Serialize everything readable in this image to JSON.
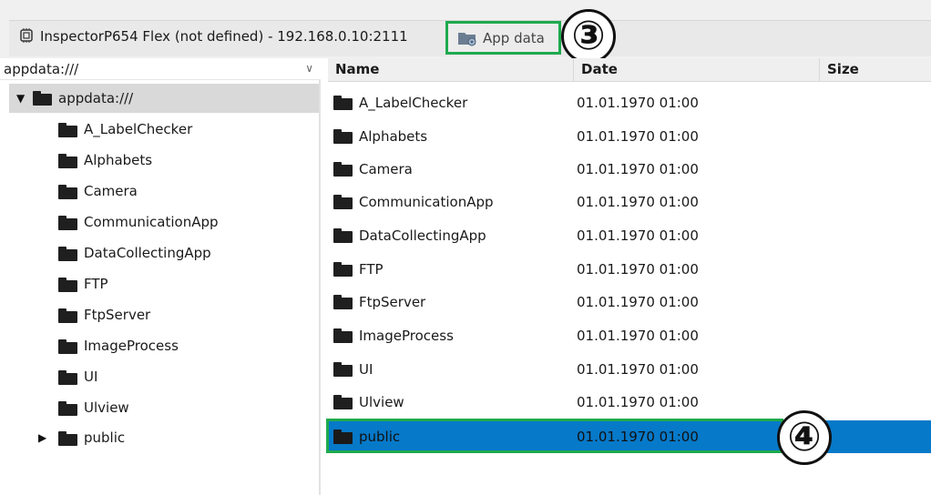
{
  "device_bar": {
    "title": "InspectorP654 Flex (not defined) - 192.168.0.10:2111",
    "appdata_button_label": "App data",
    "icons": {
      "device": "device-chip-icon",
      "appdata": "folder-gear-icon"
    }
  },
  "callouts": {
    "app_data": "③",
    "selected_row": "④"
  },
  "tree": {
    "path_value": "appdata:///",
    "root_label": "appdata:///",
    "items": [
      {
        "label": "A_LabelChecker"
      },
      {
        "label": "Alphabets"
      },
      {
        "label": "Camera"
      },
      {
        "label": "CommunicationApp"
      },
      {
        "label": "DataCollectingApp"
      },
      {
        "label": "FTP"
      },
      {
        "label": "FtpServer"
      },
      {
        "label": "ImageProcess"
      },
      {
        "label": "UI"
      },
      {
        "label": "Ulview"
      },
      {
        "label": "public",
        "expandable": true
      }
    ]
  },
  "list": {
    "columns": [
      "Name",
      "Date",
      "Size"
    ],
    "rows": [
      {
        "name": "A_LabelChecker",
        "date": "01.01.1970 01:00"
      },
      {
        "name": "Alphabets",
        "date": "01.01.1970 01:00"
      },
      {
        "name": "Camera",
        "date": "01.01.1970 01:00"
      },
      {
        "name": "CommunicationApp",
        "date": "01.01.1970 01:00"
      },
      {
        "name": "DataCollectingApp",
        "date": "01.01.1970 01:00"
      },
      {
        "name": "FTP",
        "date": "01.01.1970 01:00"
      },
      {
        "name": "FtpServer",
        "date": "01.01.1970 01:00"
      },
      {
        "name": "ImageProcess",
        "date": "01.01.1970 01:00"
      },
      {
        "name": "UI",
        "date": "01.01.1970 01:00"
      },
      {
        "name": "Ulview",
        "date": "01.01.1970 01:00"
      },
      {
        "name": "public",
        "date": "01.01.1970 01:00",
        "selected": true
      }
    ]
  },
  "colors": {
    "selection": "#0779c9",
    "highlight_outline": "#1eaa4e",
    "tree_root_bg": "#d9d9d9"
  }
}
